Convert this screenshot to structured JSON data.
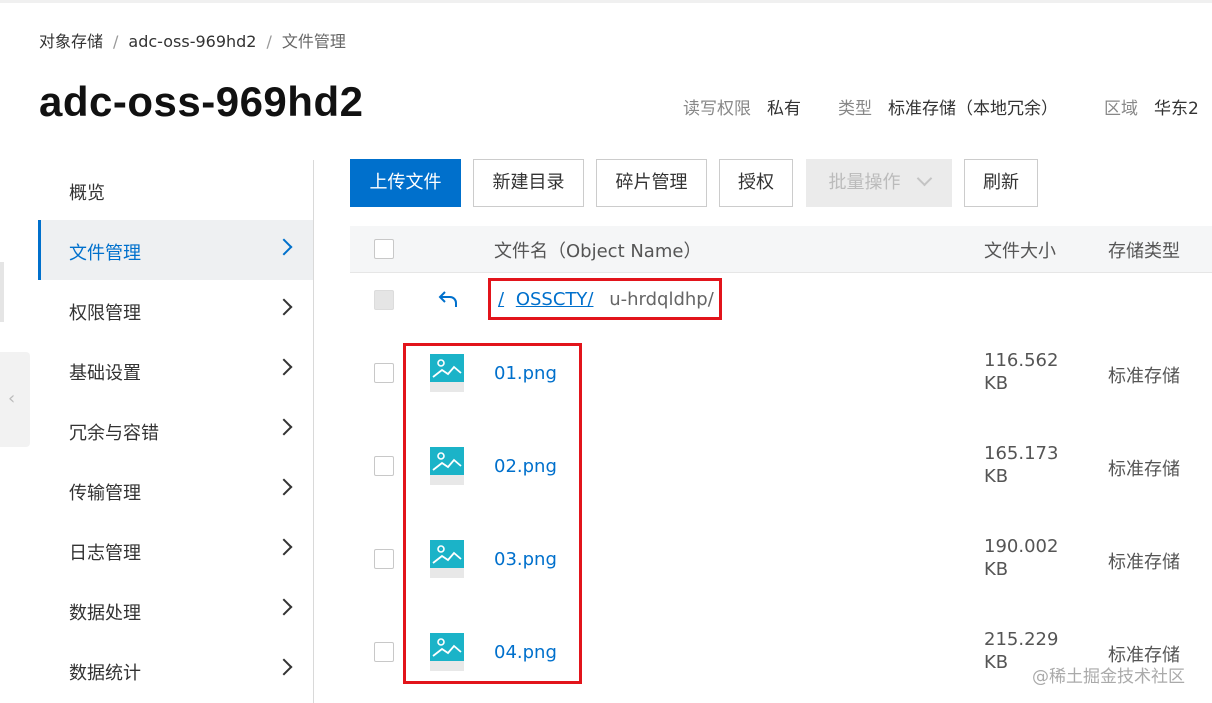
{
  "breadcrumb": {
    "items": [
      "对象存储",
      "adc-oss-969hd2",
      "文件管理"
    ],
    "separator": "/"
  },
  "bucket": {
    "title": "adc-oss-969hd2",
    "meta": [
      {
        "label": "读写权限",
        "value": "私有"
      },
      {
        "label": "类型",
        "value": "标准存储（本地冗余）"
      },
      {
        "label": "区域",
        "value": "华东2"
      }
    ]
  },
  "sidebar": {
    "items": [
      {
        "label": "概览",
        "chevron": false,
        "active": false
      },
      {
        "label": "文件管理",
        "chevron": true,
        "active": true
      },
      {
        "label": "权限管理",
        "chevron": true,
        "active": false
      },
      {
        "label": "基础设置",
        "chevron": true,
        "active": false
      },
      {
        "label": "冗余与容错",
        "chevron": true,
        "active": false
      },
      {
        "label": "传输管理",
        "chevron": true,
        "active": false
      },
      {
        "label": "日志管理",
        "chevron": true,
        "active": false
      },
      {
        "label": "数据处理",
        "chevron": true,
        "active": false
      },
      {
        "label": "数据统计",
        "chevron": true,
        "active": false
      }
    ]
  },
  "toolbar": {
    "upload": "上传文件",
    "new_dir": "新建目录",
    "fragments": "碎片管理",
    "authorize": "授权",
    "batch": "批量操作",
    "refresh": "刷新"
  },
  "table": {
    "headers": {
      "name": "文件名（Object Name）",
      "size": "文件大小",
      "storage": "存储类型"
    },
    "path": {
      "root": "/",
      "folder": "OSSCTY/",
      "current": "u-hrdqldhp/"
    },
    "rows": [
      {
        "name": "01.png",
        "size_value": "116.562",
        "size_unit": "KB",
        "storage": "标准存储"
      },
      {
        "name": "02.png",
        "size_value": "165.173",
        "size_unit": "KB",
        "storage": "标准存储"
      },
      {
        "name": "03.png",
        "size_value": "190.002",
        "size_unit": "KB",
        "storage": "标准存储"
      },
      {
        "name": "04.png",
        "size_value": "215.229",
        "size_unit": "KB",
        "storage": "标准存储"
      }
    ]
  },
  "watermark": "@稀土掘金技术社区",
  "colors": {
    "accent": "#0070cc",
    "highlight": "#e2141b",
    "icon_teal": "#1bb3c8"
  }
}
